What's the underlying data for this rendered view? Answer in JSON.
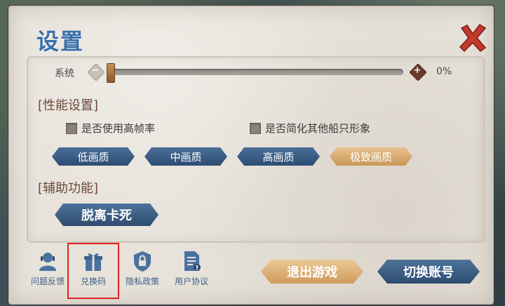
{
  "title": "设置",
  "volume": {
    "label": "系统",
    "value_text": "0%",
    "level": 0
  },
  "performance": {
    "section_title": "[性能设置]",
    "checkbox_high_fps": "是否使用高帧率",
    "checkbox_simplify_ships": "是否简化其他船只形象",
    "quality_options": [
      "低画质",
      "中画质",
      "高画质",
      "极致画质"
    ],
    "selected_quality": "极致画质"
  },
  "assist": {
    "section_title": "[辅助功能]",
    "unstuck_label": "脱离卡死"
  },
  "bottom_nav": [
    {
      "label": "问题反馈",
      "icon": "customer-service-icon"
    },
    {
      "label": "兑换码",
      "icon": "gift-icon"
    },
    {
      "label": "隐私政策",
      "icon": "privacy-lock-icon"
    },
    {
      "label": "用户协议",
      "icon": "document-icon"
    }
  ],
  "actions": {
    "exit_label": "退出游戏",
    "switch_label": "切换账号"
  },
  "colors": {
    "accent_blue": "#3a6fa8",
    "selected_gold": "#d9a86a",
    "highlight_red": "#e02020",
    "close_red": "#c0392b"
  }
}
